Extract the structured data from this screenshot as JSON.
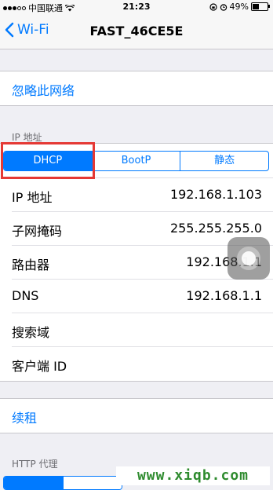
{
  "status_bar": {
    "carrier": "中国联通",
    "time": "21:23",
    "battery": "49%",
    "battery_level": 0.49
  },
  "nav": {
    "back_label": "Wi-Fi",
    "title": "FAST_46CE5E"
  },
  "forget_network": "忽略此网络",
  "ip_section": {
    "header": "IP 地址",
    "segments": [
      "DHCP",
      "BootP",
      "静态"
    ],
    "selected": "DHCP",
    "rows": [
      {
        "label": "IP 地址",
        "value": "192.168.1.103"
      },
      {
        "label": "子网掩码",
        "value": "255.255.255.0"
      },
      {
        "label": "路由器",
        "value": "192.168.1.1"
      },
      {
        "label": "DNS",
        "value": "192.168.1.1"
      },
      {
        "label": "搜索域",
        "value": ""
      },
      {
        "label": "客户端 ID",
        "value": ""
      }
    ]
  },
  "renew_lease": "续租",
  "http_proxy": {
    "header": "HTTP 代理"
  },
  "watermark": "www.xiqb.com",
  "colors": {
    "accent": "#007aff",
    "highlight_box": "#e53935",
    "watermark": "#2e8b2e"
  }
}
